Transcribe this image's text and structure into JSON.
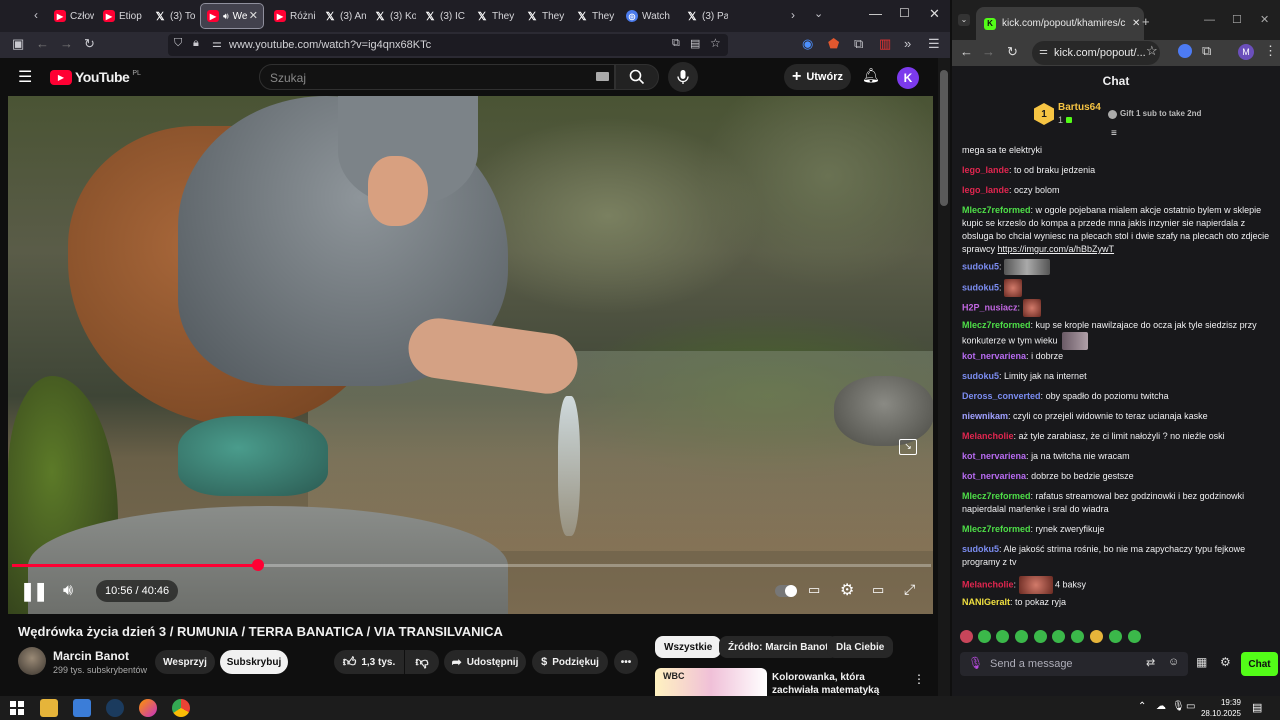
{
  "firefox": {
    "tabs": [
      {
        "label": "Człow",
        "icon": "youtube-icon"
      },
      {
        "label": "Etiop",
        "icon": "youtube-icon"
      },
      {
        "label": "(3) To",
        "icon": "x-icon"
      },
      {
        "label": "We",
        "icon": "youtube-icon",
        "active": true
      },
      {
        "label": "Różni",
        "icon": "youtube-icon"
      },
      {
        "label": "(3) An",
        "icon": "x-icon"
      },
      {
        "label": "(3) Ko",
        "icon": "x-icon"
      },
      {
        "label": "(3) IC",
        "icon": "x-icon"
      },
      {
        "label": "They",
        "icon": "x-icon"
      },
      {
        "label": "They",
        "icon": "x-icon"
      },
      {
        "label": "They",
        "icon": "x-icon"
      },
      {
        "label": "Watch",
        "icon": "web-icon"
      },
      {
        "label": "(3) Pa",
        "icon": "x-icon"
      }
    ],
    "url": "www.youtube.com/watch?v=ig4qnx68KTc"
  },
  "youtube": {
    "logo_text": "YouTube",
    "logo_region": "PL",
    "search_placeholder": "Szukaj",
    "create_label": "Utwórz",
    "avatar_letter": "K",
    "video": {
      "current_time": "10:56",
      "separator": "/",
      "duration": "40:46",
      "progress_fraction": 0.268
    },
    "title": "Wędrówka życia dzień 3 / RUMUNIA / TERRA BANATICA / VIA TRANSILVANICA",
    "channel": {
      "name": "Marcin Banot",
      "subscribers": "299 tys. subskrybentów"
    },
    "actions": {
      "support": "Wesprzyj",
      "subscribe": "Subskrybuj",
      "likes": "1,3 tys.",
      "share": "Udostępnij",
      "thanks": "Podziękuj"
    },
    "chips": [
      "Wszystkie",
      "Źródło: Marcin Banot",
      "Dla Ciebie"
    ],
    "recommended": {
      "title": "Kolorowanka, która zachwiała matematyką",
      "thumb_text": "WBC"
    }
  },
  "chrome": {
    "tab_label": "kick.com/popout/khamires/cha",
    "url": "kick.com/popout/...",
    "profile_letter": "M"
  },
  "chat": {
    "header": "Chat",
    "pinned": {
      "user": "Bartus64",
      "rank": "1",
      "count": "1",
      "text": "Gift 1 sub to take 2nd"
    },
    "messages": [
      {
        "user": "",
        "color": "#efeff1",
        "text": "mega sa te elektryki"
      },
      {
        "user": "lego_lande",
        "color": "#e0264f",
        "text": "to od braku jedzenia"
      },
      {
        "user": "lego_lande",
        "color": "#e0264f",
        "text": "oczy bolom"
      },
      {
        "user": "Mlecz7reformed",
        "color": "#4ede48",
        "text": "w ogole pojebana mialem akcje ostatnio bylem w sklepie kupic se krzeslo do kompa a przede mna jakis inzynier sie napierdala z obsluga bo chcial wyniesc na plecach stol i dwie szafy na plecach oto zdjecie sprawcy ",
        "link": "https://imgur.com/a/hBbZywT"
      },
      {
        "user": "sudoku5",
        "color": "#7b8cf0",
        "text": "",
        "emote": "emote-image"
      },
      {
        "user": "sudoku5",
        "color": "#7b8cf0",
        "text": "",
        "emote": "emote-image"
      },
      {
        "user": "H2P_nusiacz",
        "color": "#c066e0",
        "text": "",
        "emote": "emote-image"
      },
      {
        "user": "Mlecz7reformed",
        "color": "#4ede48",
        "text": "kup se krople nawilzajace do ocza jak tyle siedzisz przy konkuterze w tym wieku"
      },
      {
        "user": "kot_nervariena",
        "color": "#b76bf0",
        "text": "i dobrze"
      },
      {
        "user": "sudoku5",
        "color": "#7b8cf0",
        "text": "Limity jak na internet"
      },
      {
        "user": "Deross_converted",
        "color": "#7b8cf0",
        "text": "oby spadło do poziomu twitcha"
      },
      {
        "user": "niewnikam",
        "color": "#a0a0ff",
        "text": "czyli co przejeli widownie to teraz ucianaja kaske"
      },
      {
        "user": "Melancholie",
        "color": "#e0264f",
        "text": "aż tyle zarabiasz, że ci limit nałożyli ? no nieźle oski"
      },
      {
        "user": "kot_nervariena",
        "color": "#b76bf0",
        "text": "ja na twitcha nie wracam"
      },
      {
        "user": "kot_nervariena",
        "color": "#b76bf0",
        "text": "dobrze bo bedzie gestsze"
      },
      {
        "user": "Mlecz7reformed",
        "color": "#4ede48",
        "text": "rafatus streamowal bez godzinowki i bez godzinowki napierdalal marlenke i sral do wiadra"
      },
      {
        "user": "Mlecz7reformed",
        "color": "#4ede48",
        "text": "rynek zweryfikuje"
      },
      {
        "user": "sudoku5",
        "color": "#7b8cf0",
        "text": "Ale jakość strima rośnie, bo nie ma zapychaczy typu fejkowe programy z tv"
      },
      {
        "user": "Melancholie",
        "color": "#e0264f",
        "text": " 4 baksy",
        "emote": "emote-image"
      },
      {
        "user": "NANIGeralt",
        "color": "#f0e040",
        "text": "to pokaz ryja"
      }
    ],
    "input_placeholder": "Send a message",
    "send_label": "Chat"
  },
  "taskbar": {
    "time": "19:39",
    "date": "28.10.2025"
  }
}
